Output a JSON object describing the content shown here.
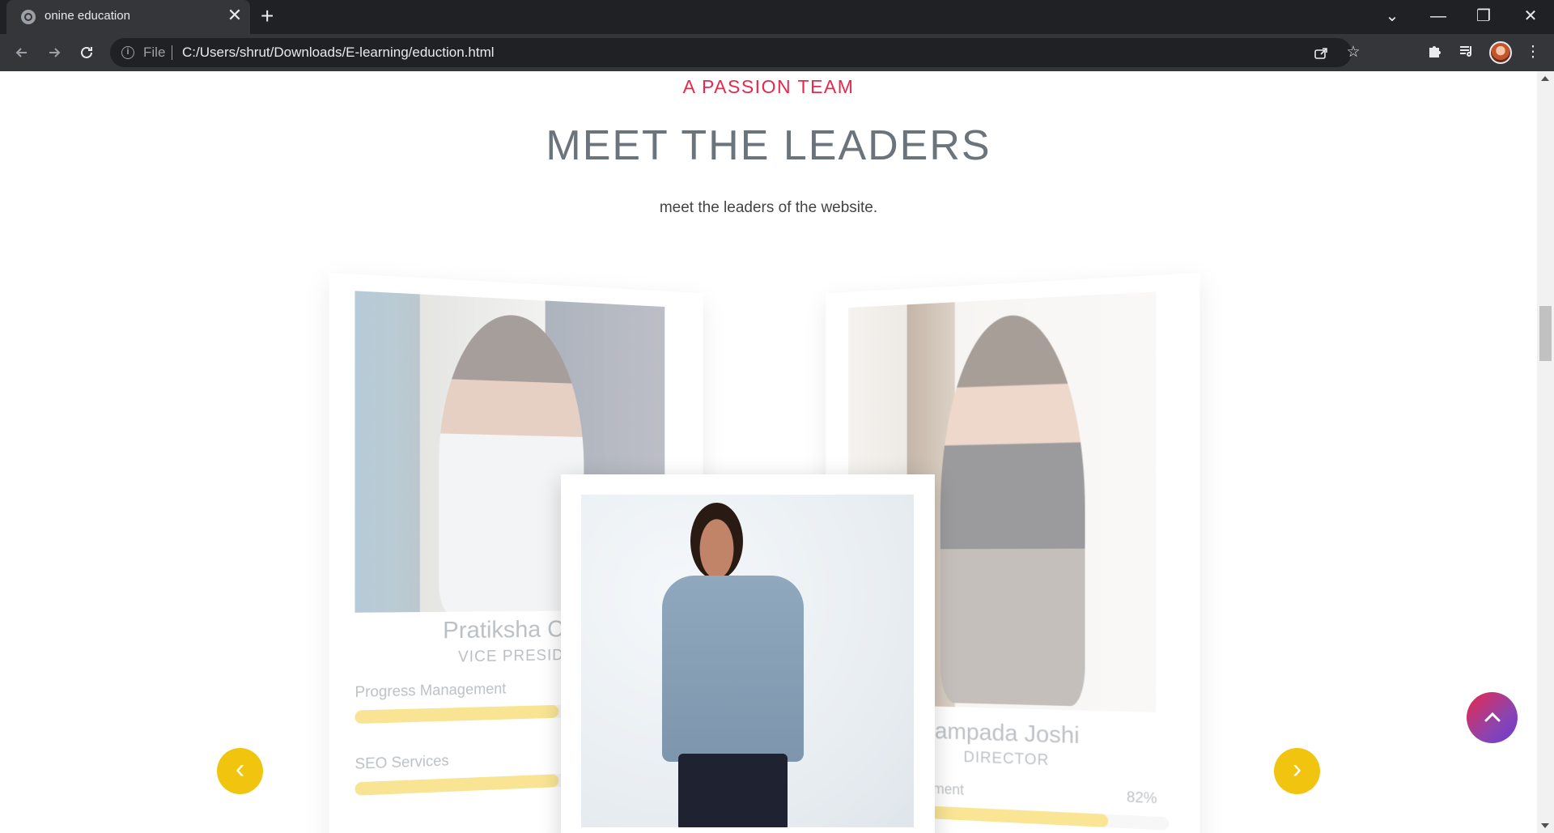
{
  "browser": {
    "tab_title": "onine education",
    "tab_close": "✕",
    "new_tab": "+",
    "scheme": "File",
    "url": "C:/Users/shrut/Downloads/E-learning/eduction.html",
    "icons": {
      "back": "back-arrow-icon",
      "forward": "forward-arrow-icon",
      "reload": "reload-icon",
      "info": "info-icon",
      "share": "share-icon",
      "star": "bookmark-star-icon",
      "extensions": "puzzle-icon",
      "media": "media-queue-icon",
      "menu": "kebab-menu-icon"
    },
    "window": {
      "minimize": "—",
      "restore": "❐",
      "close": "✕",
      "tab_search": "⌄"
    }
  },
  "section": {
    "eyebrow": "A PASSION TEAM",
    "heading": "MEET THE LEADERS",
    "subtitle": "meet the leaders of the website."
  },
  "leaders": {
    "left": {
      "name": "Pratiksha Chita",
      "role": "VICE PRESIDEN",
      "skills": [
        {
          "label": "Progress Management",
          "value": 0.62
        },
        {
          "label": "SEO Services",
          "value": 0.62
        }
      ]
    },
    "right": {
      "name": "ampada Joshi",
      "role": "DIRECTOR",
      "skills": [
        {
          "label": "gement",
          "pct": "82%",
          "value": 0.82
        }
      ]
    },
    "front": {
      "caption": ""
    }
  },
  "controls": {
    "prev": "‹",
    "next": "›",
    "to_top": "⌃"
  },
  "colors": {
    "accent_red": "#e8284b",
    "accent_yellow": "#f1c40f",
    "heading_gray": "#6b747d"
  }
}
